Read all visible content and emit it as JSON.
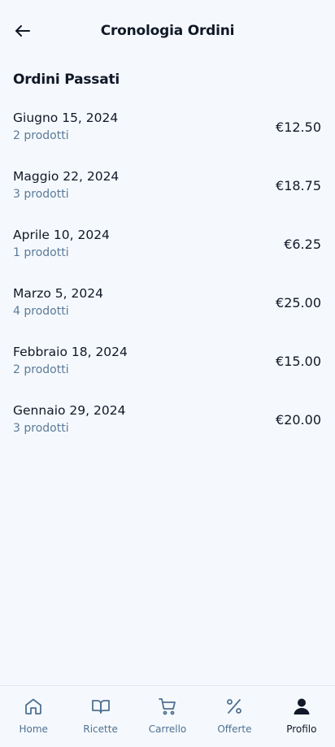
{
  "header": {
    "title": "Cronologia Ordini",
    "back_icon": "arrow-left-icon"
  },
  "section": {
    "title": "Ordini Passati"
  },
  "orders": [
    {
      "date": "Giugno 15, 2024",
      "count": "2 prodotti",
      "price": "€12.50"
    },
    {
      "date": "Maggio 22, 2024",
      "count": "3 prodotti",
      "price": "€18.75"
    },
    {
      "date": "Aprile 10, 2024",
      "count": "1 prodotti",
      "price": "€6.25"
    },
    {
      "date": "Marzo 5, 2024",
      "count": "4 prodotti",
      "price": "€25.00"
    },
    {
      "date": "Febbraio 18, 2024",
      "count": "2 prodotti",
      "price": "€15.00"
    },
    {
      "date": "Gennaio 29, 2024",
      "count": "3 prodotti",
      "price": "€20.00"
    }
  ],
  "nav": [
    {
      "label": "Home",
      "icon": "home-icon"
    },
    {
      "label": "Ricette",
      "icon": "book-icon"
    },
    {
      "label": "Carrello",
      "icon": "cart-icon"
    },
    {
      "label": "Offerte",
      "icon": "percent-icon"
    },
    {
      "label": "Profilo",
      "icon": "person-icon",
      "active": true
    }
  ],
  "colors": {
    "background": "#f5f9fd",
    "text": "#111827",
    "muted": "#5b7a99",
    "nav_inactive": "#4f7090"
  }
}
